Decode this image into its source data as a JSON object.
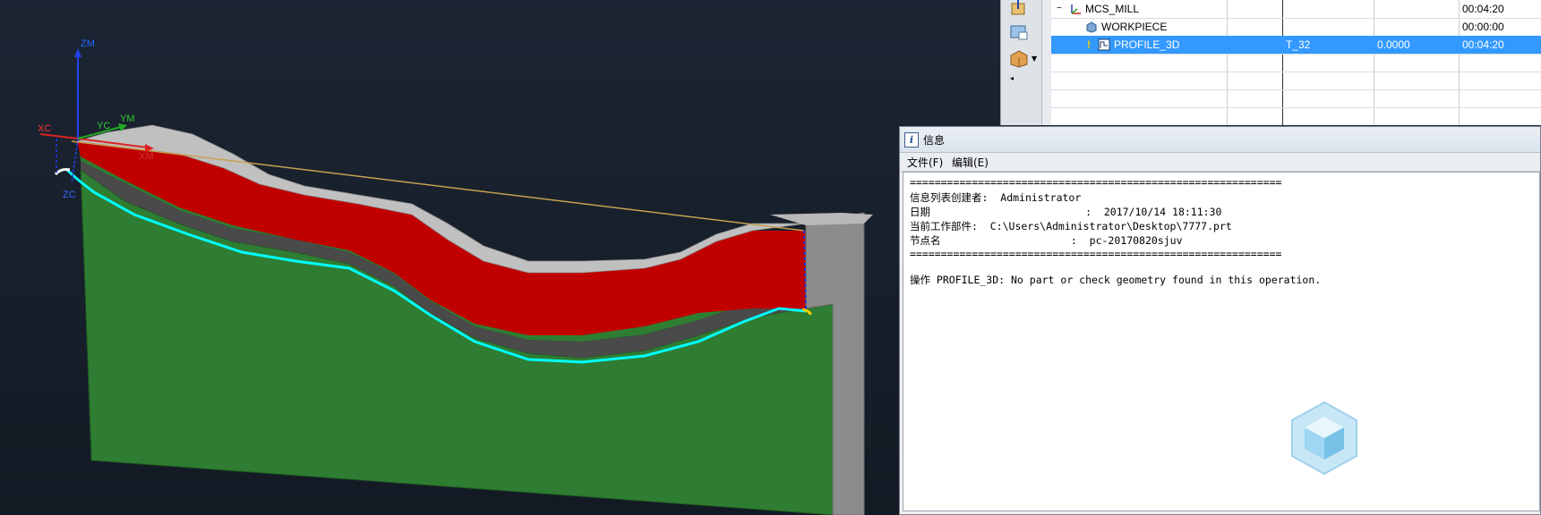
{
  "axes": {
    "zm": "ZM",
    "xc": "XC",
    "yc": "YC",
    "ym": "YM",
    "xm": "XM",
    "zc": "ZC"
  },
  "colors": {
    "background": "#1a2330",
    "wall_top": "#c0c0c0",
    "red_layer": "#c00000",
    "green_body": "#2e7d32",
    "toolpath": "#00ffff",
    "selection": "#3399ff"
  },
  "navigator": {
    "tool_icons": [
      "wcs-icon",
      "workpiece-icon",
      "box-icon"
    ],
    "rows": [
      {
        "name": "MCS_MILL",
        "tool": "",
        "offset": "",
        "time": "00:04:20",
        "status": "",
        "icon": "mcs-icon"
      },
      {
        "name": "WORKPIECE",
        "tool": "",
        "offset": "",
        "time": "00:00:00",
        "status": "",
        "icon": "workpiece-icon"
      },
      {
        "name": "PROFILE_3D",
        "tool": "T_32",
        "offset": "0.0000",
        "time": "00:04:20",
        "status": "check-icon",
        "icon": "operation-icon"
      }
    ]
  },
  "info_window": {
    "title": "信息",
    "menu": {
      "file": "文件(F)",
      "edit": "编辑(E)"
    },
    "lines": [
      "============================================================",
      "信息列表创建者:  Administrator",
      "日期                         :  2017/10/14 18:11:30",
      "当前工作部件:  C:\\Users\\Administrator\\Desktop\\7777.prt",
      "节点名                     :  pc-20170820sjuv",
      "============================================================",
      "",
      "操作 PROFILE_3D: No part or check geometry found in this operation."
    ]
  }
}
